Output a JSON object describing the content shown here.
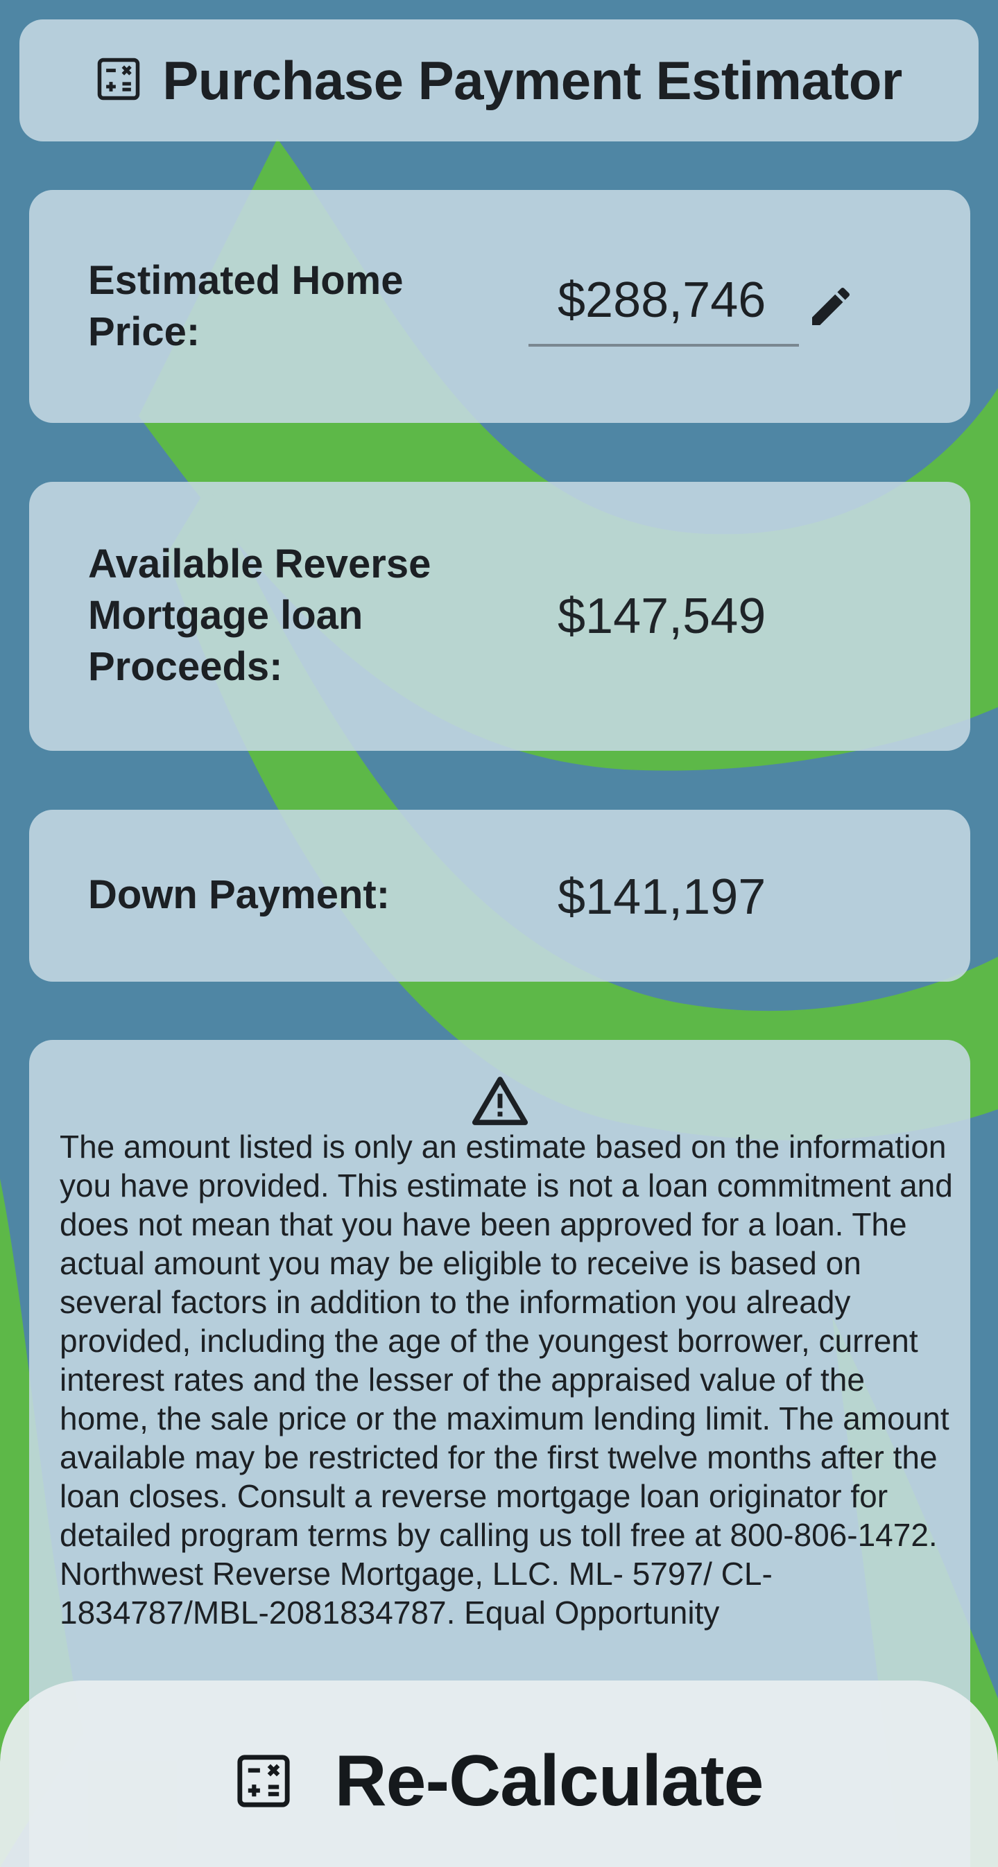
{
  "header": {
    "title": "Purchase Payment Estimator",
    "icon": "calculator-icon"
  },
  "home_price": {
    "label": "Estimated Home Price:",
    "value": "$288,746",
    "edit_icon": "pencil-icon"
  },
  "loan_proceeds": {
    "label": "Available Reverse Mortgage loan Proceeds:",
    "value": "$147,549"
  },
  "down_payment": {
    "label": "Down Payment:",
    "value": "$141,197"
  },
  "disclaimer": {
    "icon": "warning-icon",
    "text": "The amount listed is only an estimate based on the information you have provided. This estimate is not a loan commitment and does not mean that you have been approved for a loan. The actual amount you may be eligible to receive is based on several factors in addition to the information you already provided, including the age of the youngest borrower, current interest rates and the lesser of the appraised value of the home, the sale price or the maximum lending limit. The amount available may be restricted for the first twelve months after the loan closes. Consult a reverse mortgage loan originator for detailed program terms by calling us toll free at 800-806-1472. Northwest Reverse Mortgage, LLC. ML- 5797/ CL-1834787/MBL-2081834787. Equal Opportunity"
  },
  "action": {
    "label": "Re-Calculate",
    "icon": "calculator-icon"
  },
  "colors": {
    "background": "#4f86a4",
    "accent_green": "#5db848",
    "card": "#c5d8e2"
  }
}
